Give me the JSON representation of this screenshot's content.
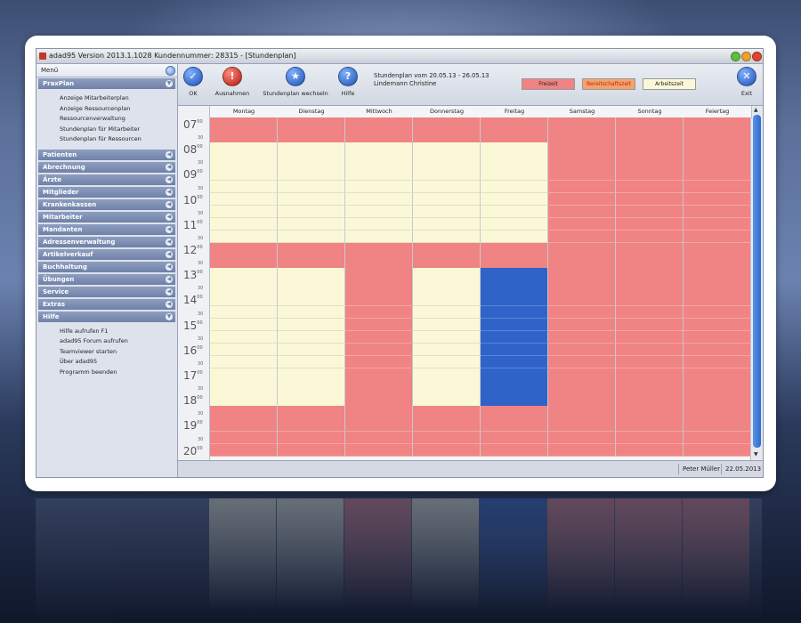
{
  "window": {
    "title": "adad95  Version 2013.1.1028  Kundennummer: 28315 - [Stundenplan]"
  },
  "sidebar": {
    "menu_label": "Menü",
    "sections": [
      {
        "label": "PraxPlan",
        "expanded": true,
        "items": [
          "Anzeige Mitarbeiterplan",
          "Anzeige Ressourcenplan",
          "Ressourcenverwaltung",
          "Stundenplan für Mitarbeiter",
          "Stundenplan für Ressourcen"
        ]
      },
      {
        "label": "Patienten"
      },
      {
        "label": "Abrechnung"
      },
      {
        "label": "Ärzte"
      },
      {
        "label": "Mitglieder"
      },
      {
        "label": "Krankenkassen"
      },
      {
        "label": "Mitarbeiter"
      },
      {
        "label": "Mandanten"
      },
      {
        "label": "Adressenverwaltung"
      },
      {
        "label": "Artikelverkauf"
      },
      {
        "label": "Buchhaltung"
      },
      {
        "label": "Übungen"
      },
      {
        "label": "Service"
      },
      {
        "label": "Extras"
      },
      {
        "label": "Hilfe",
        "expanded": true,
        "items": [
          "Hilfe aufrufen F1",
          "adad95 Forum aufrufen",
          "Teamviewer starten",
          "Über adad95",
          "Programm beenden"
        ]
      }
    ]
  },
  "toolbar": {
    "ok_label": "OK",
    "exceptions_label": "Ausnahmen",
    "switch_label": "Stundenplan wechseln",
    "help_label": "Hilfe",
    "exit_label": "Exit",
    "schedule_range": "Stundenplan vom 20.05.13 - 26.05.13",
    "employee_name": "Lindemann Christine",
    "legend": [
      {
        "label": "Freizeit",
        "color": "#f08383",
        "text_color": "#222222"
      },
      {
        "label": "Bereitschaftszeit",
        "color": "#f4a36b",
        "text_color": "#b5281b"
      },
      {
        "label": "Arbeitszeit",
        "color": "#fbf8d8",
        "text_color": "#222222"
      }
    ]
  },
  "schedule": {
    "days": [
      "Montag",
      "Dienstag",
      "Mittwoch",
      "Donnerstag",
      "Freitag",
      "Samstag",
      "Sonntag",
      "Feiertag"
    ],
    "hours": [
      "07",
      "08",
      "09",
      "10",
      "11",
      "12",
      "13",
      "14",
      "15",
      "16",
      "17",
      "18",
      "19",
      "20"
    ],
    "minute_label": "00",
    "half_label": "30",
    "rows": [
      "FFFFFFFF",
      "FFFFFFFF",
      "AAAAAFFF",
      "AAAAAFFF",
      "AAAAAFFF",
      "AAAAAFFF",
      "AAAAAFFF",
      "AAAAAFFF",
      "AAAAAFFF",
      "AAAAAFFF",
      "FFFFFFFF",
      "FFFFFFFF",
      "AAFABFFF",
      "AAFABFFF",
      "AAFABFFF",
      "AAFABFFF",
      "AAFABFFF",
      "AAFABFFF",
      "AAFABFFF",
      "AAFABFFF",
      "AAFABFFF",
      "AAFABFFF",
      "AAFABFFF",
      "FFFFFFFF",
      "FFFFFFFF",
      "FFFFFFFF",
      "FFFFFFFF"
    ],
    "colors": {
      "F": "#f08383",
      "A": "#fbf8d8",
      "B": "#2f63c8"
    }
  },
  "statusbar": {
    "user": "Peter Müller",
    "date": "22.05.2013"
  }
}
